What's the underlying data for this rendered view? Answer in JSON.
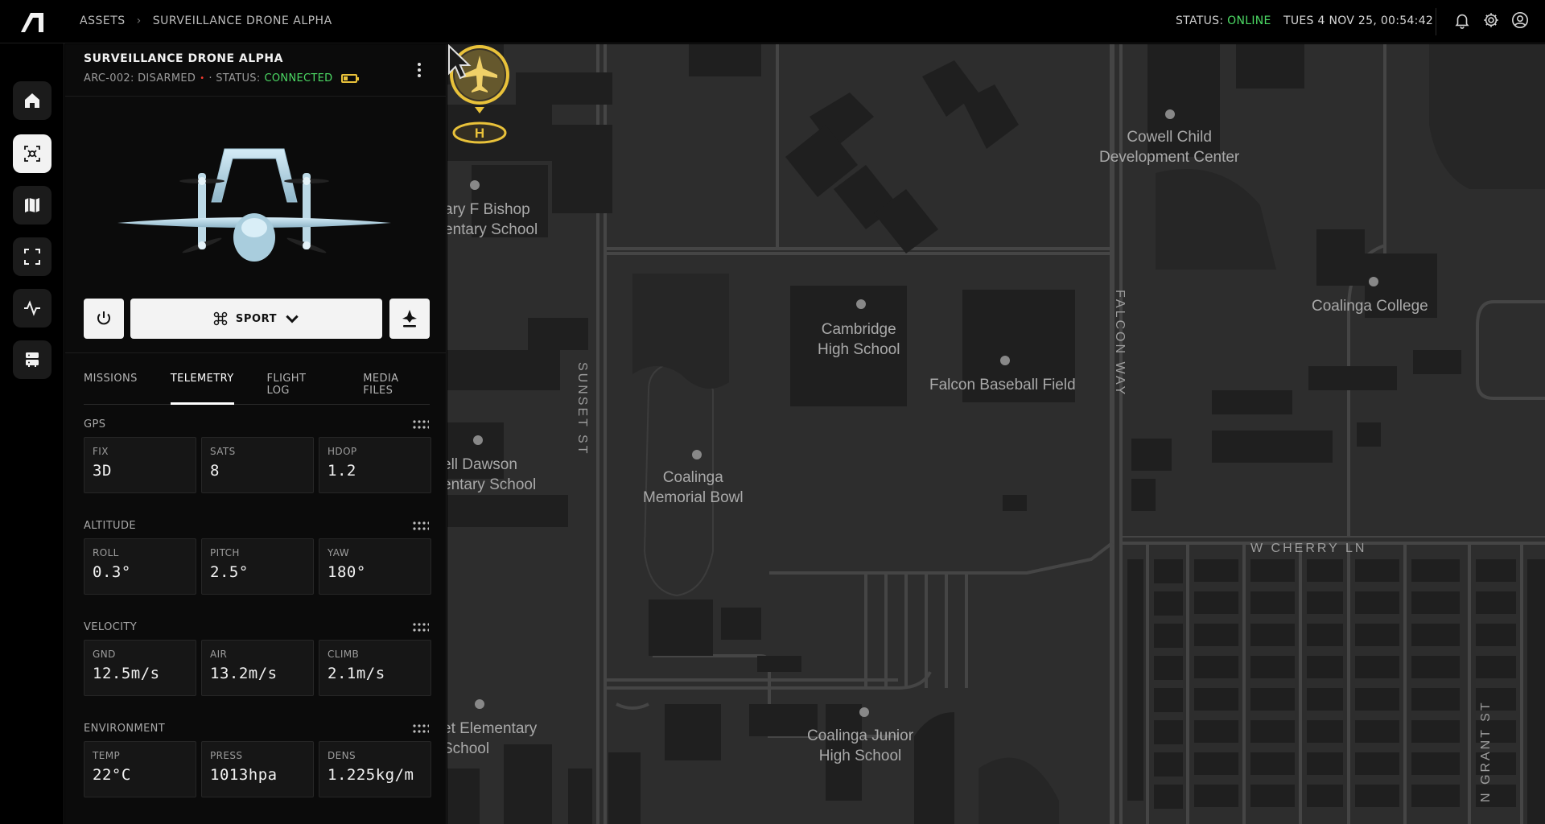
{
  "topbar": {
    "breadcrumb": [
      "ASSETS",
      "SURVEILLANCE DRONE ALPHA"
    ],
    "status_label": "STATUS:",
    "status_value": "ONLINE",
    "datetime": "TUES 4 NOV 25, 00:54:42",
    "icons": [
      "bell-icon",
      "gear-icon",
      "user-icon"
    ]
  },
  "leftnav": {
    "items": [
      "home-icon",
      "drone-icon",
      "map-icon",
      "fullscreen-icon",
      "activity-icon",
      "server-icon"
    ],
    "active": "drone-icon"
  },
  "asset": {
    "title": "SURVEILLANCE DRONE ALPHA",
    "id_state": "ARC-002: DISARMED",
    "dot": "•",
    "status_prefix": "· STATUS:",
    "status_value": "CONNECTED"
  },
  "controls": {
    "mode": "SPORT"
  },
  "tabs": [
    "MISSIONS",
    "TELEMETRY",
    "FLIGHT LOG",
    "MEDIA FILES"
  ],
  "active_tab": "TELEMETRY",
  "telemetry": {
    "gps": {
      "title": "GPS",
      "cards": [
        {
          "label": "FIX",
          "value": "3D"
        },
        {
          "label": "SATS",
          "value": "8"
        },
        {
          "label": "HDOP",
          "value": "1.2"
        }
      ]
    },
    "altitude": {
      "title": "ALTITUDE",
      "cards": [
        {
          "label": "ROLL",
          "value": "0.3°"
        },
        {
          "label": "PITCH",
          "value": "2.5°"
        },
        {
          "label": "YAW",
          "value": "180°"
        }
      ]
    },
    "velocity": {
      "title": "VELOCITY",
      "cards": [
        {
          "label": "GND",
          "value": "12.5m/s"
        },
        {
          "label": "AIR",
          "value": "13.2m/s"
        },
        {
          "label": "CLIMB",
          "value": "2.1m/s"
        }
      ]
    },
    "environment": {
      "title": "ENVIRONMENT",
      "cards": [
        {
          "label": "TEMP",
          "value": "22°C"
        },
        {
          "label": "PRESS",
          "value": "1013hpa"
        },
        {
          "label": "DENS",
          "value": "1.225kg/m"
        }
      ]
    }
  },
  "map": {
    "places": {
      "cowell": "Cowell Child\nDevelopment Center",
      "bishop": "ary F Bishop\nentary School",
      "cambridge": "Cambridge\nHigh School",
      "falcon_field": "Falcon Baseball Field",
      "coalinga_college": "Coalinga College",
      "dawson": "ell Dawson\nentary School",
      "memorial": "Coalinga\nMemorial Bowl",
      "elementary": "et Elementary\nSchool",
      "junior": "Coalinga Junior\nHigh School"
    },
    "streets": {
      "sunset": "SUNSET ST",
      "falcon_way": "FALCON WAY",
      "cherry": "W CHERRY LN",
      "grant": "N GRANT ST"
    },
    "colors": {
      "land": "#2d2d2d",
      "building": "#1f1f1f",
      "road": "#454545",
      "marker": "#e9c23a"
    }
  }
}
